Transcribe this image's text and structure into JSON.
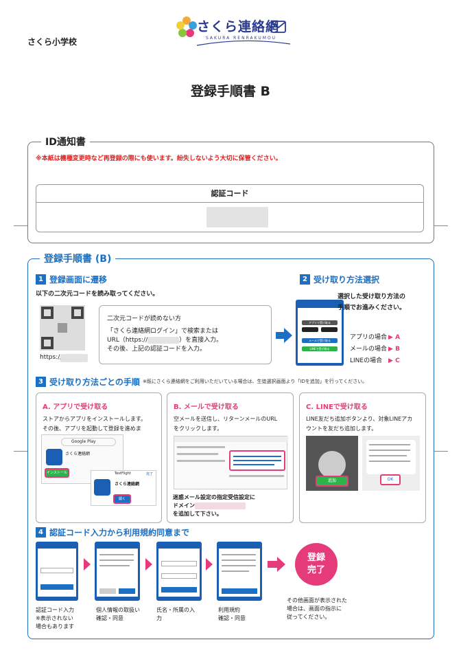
{
  "header": {
    "logo_text": "さくら連絡網",
    "logo_sub": "SAKURA RENRAKUMOU",
    "school": "さくら小学校",
    "title": "登録手順書 B"
  },
  "id_notice": {
    "title": "ID通知書",
    "warning": "※本紙は機種変更時など再登録の際にも使います。紛失しないよう大切に保管ください。",
    "code_header": "認証コード"
  },
  "procedure": {
    "title": "登録手順書 (B)",
    "step1": {
      "num": "1",
      "heading": "登録画面に遷移",
      "instruction": "以下の二次元コードを読み取ってください。",
      "url_label": "https://",
      "box_line1": "二次元コードが読めない方",
      "box_line2": "「さくら連絡網ログイン」で検索または",
      "box_line3": "URL（https://",
      "box_line3b": "）を直接入力。",
      "box_line4": "その後、上記の認証コードを入力。"
    },
    "step2": {
      "num": "2",
      "heading": "受け取り方法選択",
      "text1": "選択した受け取り方法の",
      "text2": "手順でお進みください。",
      "opt_app": "アプリの場合",
      "opt_mail": "メールの場合",
      "opt_line": "LINEの場合",
      "mark_a": "A",
      "mark_b": "B",
      "mark_c": "C",
      "phone_btn1": "アプリで受け取る",
      "phone_btn2": "メールで受け取る",
      "phone_btn3": "LINEで受け取る"
    },
    "step3": {
      "num": "3",
      "heading": "受け取り方法ごとの手順",
      "note": "※既にさくら連絡網をご利用いただいている場合は、生徒選択画面より「IDを追加」を行ってください。",
      "card_a": {
        "title": "A. アプリで受け取る",
        "line1": "ストアからアプリをインストールします。",
        "line2": "その後、アプリを起動して登録を進めま",
        "store": "Google Play",
        "app_name": "さくら連絡網",
        "install": "インストール",
        "app_name2": "さくら連絡網",
        "open": "開く",
        "done": "完了",
        "testflight": "TestFlight"
      },
      "card_b": {
        "title": "B. メールで受け取る",
        "line1": "空メールを送信し、リターンメールのURL",
        "line2": "をクリックします。",
        "note1": "迷惑メール設定の指定受信設定に",
        "note2": "ドメイン",
        "note3": "を追加して下さい。"
      },
      "card_c": {
        "title": "C. LINEで受け取る",
        "line1": "LINE友だち追加ボタンより、対象LINEアカ",
        "line2": "ウントを友だち追加します。",
        "add": "追加",
        "ok": "OK"
      }
    },
    "step4": {
      "num": "4",
      "heading": "認証コード入力から利用規約同意まで",
      "s1a": "認証コード入力",
      "s1b": "※表示されない",
      "s1c": "場合もあります",
      "s2a": "個人情報の取扱い",
      "s2b": "確認・同意",
      "s3a": "氏名・所属の入",
      "s3b": "力",
      "s4a": "利用規約",
      "s4b": "確認・同意",
      "done1": "登録",
      "done2": "完了",
      "other1": "その他画面が表示された",
      "other2": "場合は、画面の指示に",
      "other3": "従ってください。"
    }
  }
}
